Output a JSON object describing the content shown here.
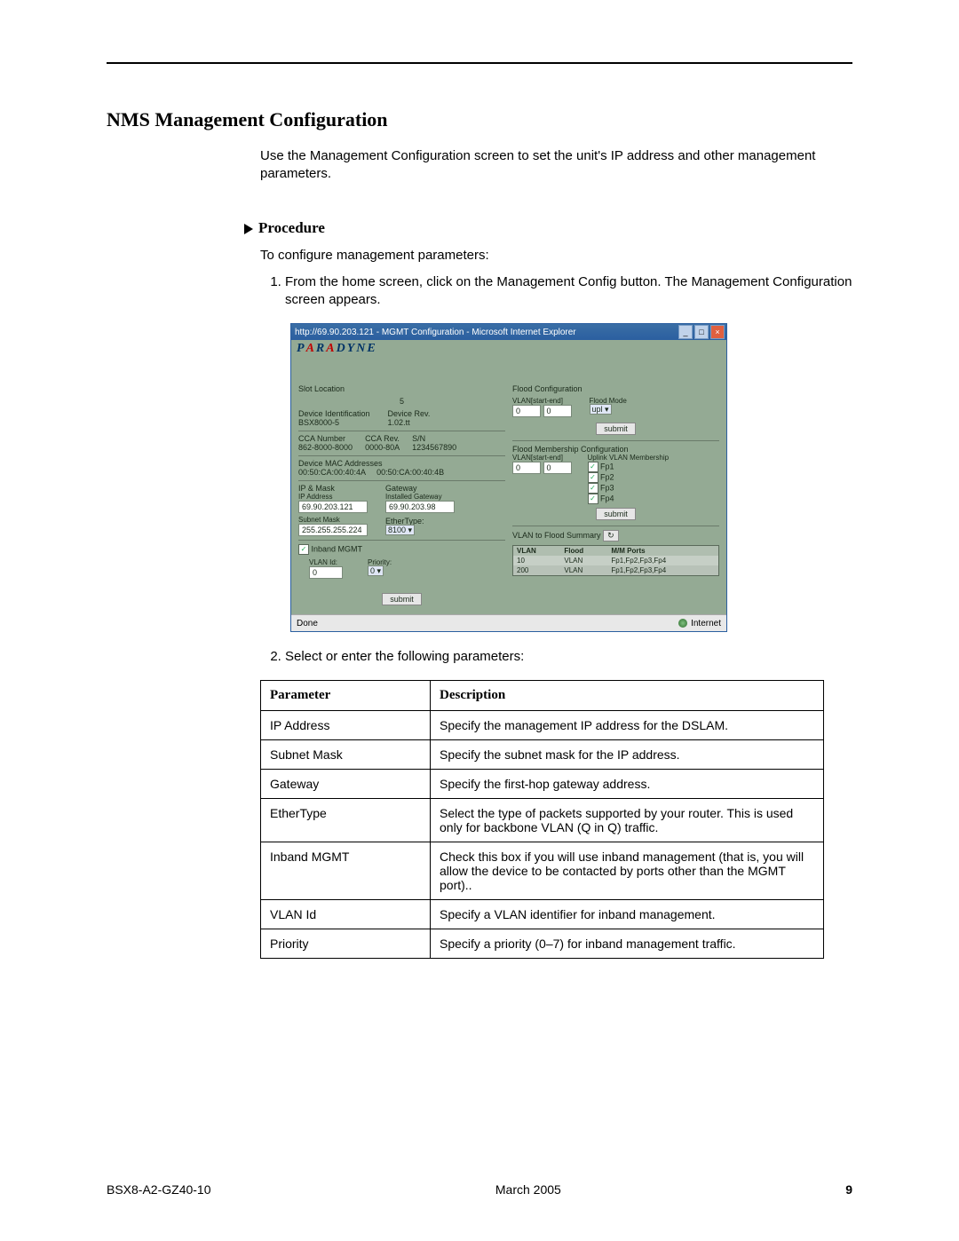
{
  "page": {
    "section_title": "NMS Management Configuration",
    "intro": "Use the Management Configuration screen to set the unit's IP address and other management parameters.",
    "procedure_label": "Procedure",
    "procedure_intro": "To configure management parameters:",
    "steps": [
      "From the home screen, click on the Management Config button. The Management Configuration screen appears.",
      "Select or enter the following parameters:"
    ]
  },
  "screenshot": {
    "window_title": "http://69.90.203.121 - MGMT Configuration - Microsoft Internet Explorer",
    "brand": "PARADYNE",
    "left_panel": {
      "slot_location_label": "Slot Location",
      "slot_location_value": "5",
      "device_ident_label": "Device Identification",
      "device_ident_value": "BSX8000-5",
      "device_rev_label": "Device Rev.",
      "device_rev_value": "1.02.tt",
      "cca_number_label": "CCA Number",
      "cca_number_value": "862-8000-8000",
      "cca_rev_label": "CCA Rev.",
      "cca_rev_value": "0000-80A",
      "sn_label": "S/N",
      "sn_value": "1234567890",
      "mac_label": "Device MAC Addresses",
      "mac_a": "00:50:CA:00:40:4A",
      "mac_b": "00:50:CA:00:40:4B",
      "ip_mask_label": "IP & Mask",
      "ip_addr_label": "IP Address",
      "ip_addr_value": "69.90.203.121",
      "subnet_label": "Subnet Mask",
      "subnet_value": "255.255.255.224",
      "gateway_label": "Gateway",
      "installed_gateway_label": "Installed Gateway",
      "gateway_value": "69.90.203.98",
      "ethertype_label": "EtherType:",
      "ethertype_value": "8100",
      "inband_label": "Inband MGMT",
      "vlan_id_label": "VLAN Id:",
      "vlan_id_value": "0",
      "priority_label": "Priority:",
      "priority_value": "0",
      "submit": "submit"
    },
    "right_panel": {
      "flood_cfg_label": "Flood Configuration",
      "vlan_range_label": "VLAN[start-end]",
      "vlan_start": "0",
      "vlan_end": "0",
      "flood_mode_label": "Flood Mode",
      "flood_mode_value": "upl",
      "submit": "submit",
      "flood_mem_label": "Flood Membership Configuration",
      "uplink_label": "Uplink VLAN Membership",
      "fp_ports": [
        "Fp1",
        "Fp2",
        "Fp3",
        "Fp4"
      ],
      "summary_label": "VLAN to Flood Summary",
      "summary_headers": [
        "VLAN",
        "Flood",
        "M/M Ports"
      ],
      "summary_rows": [
        {
          "vlan": "10",
          "flood": "VLAN",
          "ports": "Fp1,Fp2,Fp3,Fp4"
        },
        {
          "vlan": "200",
          "flood": "VLAN",
          "ports": "Fp1,Fp2,Fp3,Fp4"
        }
      ]
    },
    "status_left": "Done",
    "status_right": "Internet"
  },
  "table": {
    "headers": {
      "param": "Parameter",
      "desc": "Description"
    },
    "rows": [
      {
        "param": "IP Address",
        "desc": "Specify the management IP address for the DSLAM."
      },
      {
        "param": "Subnet Mask",
        "desc": "Specify the subnet mask for the IP address."
      },
      {
        "param": "Gateway",
        "desc": "Specify the first-hop gateway address."
      },
      {
        "param": "EtherType",
        "desc": "Select the type of packets supported by your router. This is used only for backbone VLAN (Q in Q) traffic."
      },
      {
        "param": "Inband MGMT",
        "desc": "Check this box if you will use inband management (that is, you will allow the device to be contacted by ports other than the MGMT port).."
      },
      {
        "param": "VLAN Id",
        "desc": "Specify a VLAN identifier for inband management."
      },
      {
        "param": "Priority",
        "desc": "Specify a priority (0–7) for inband management traffic."
      }
    ]
  },
  "footer": {
    "docid": "BSX8-A2-GZ40-10",
    "date": "March 2005",
    "page": "9"
  }
}
